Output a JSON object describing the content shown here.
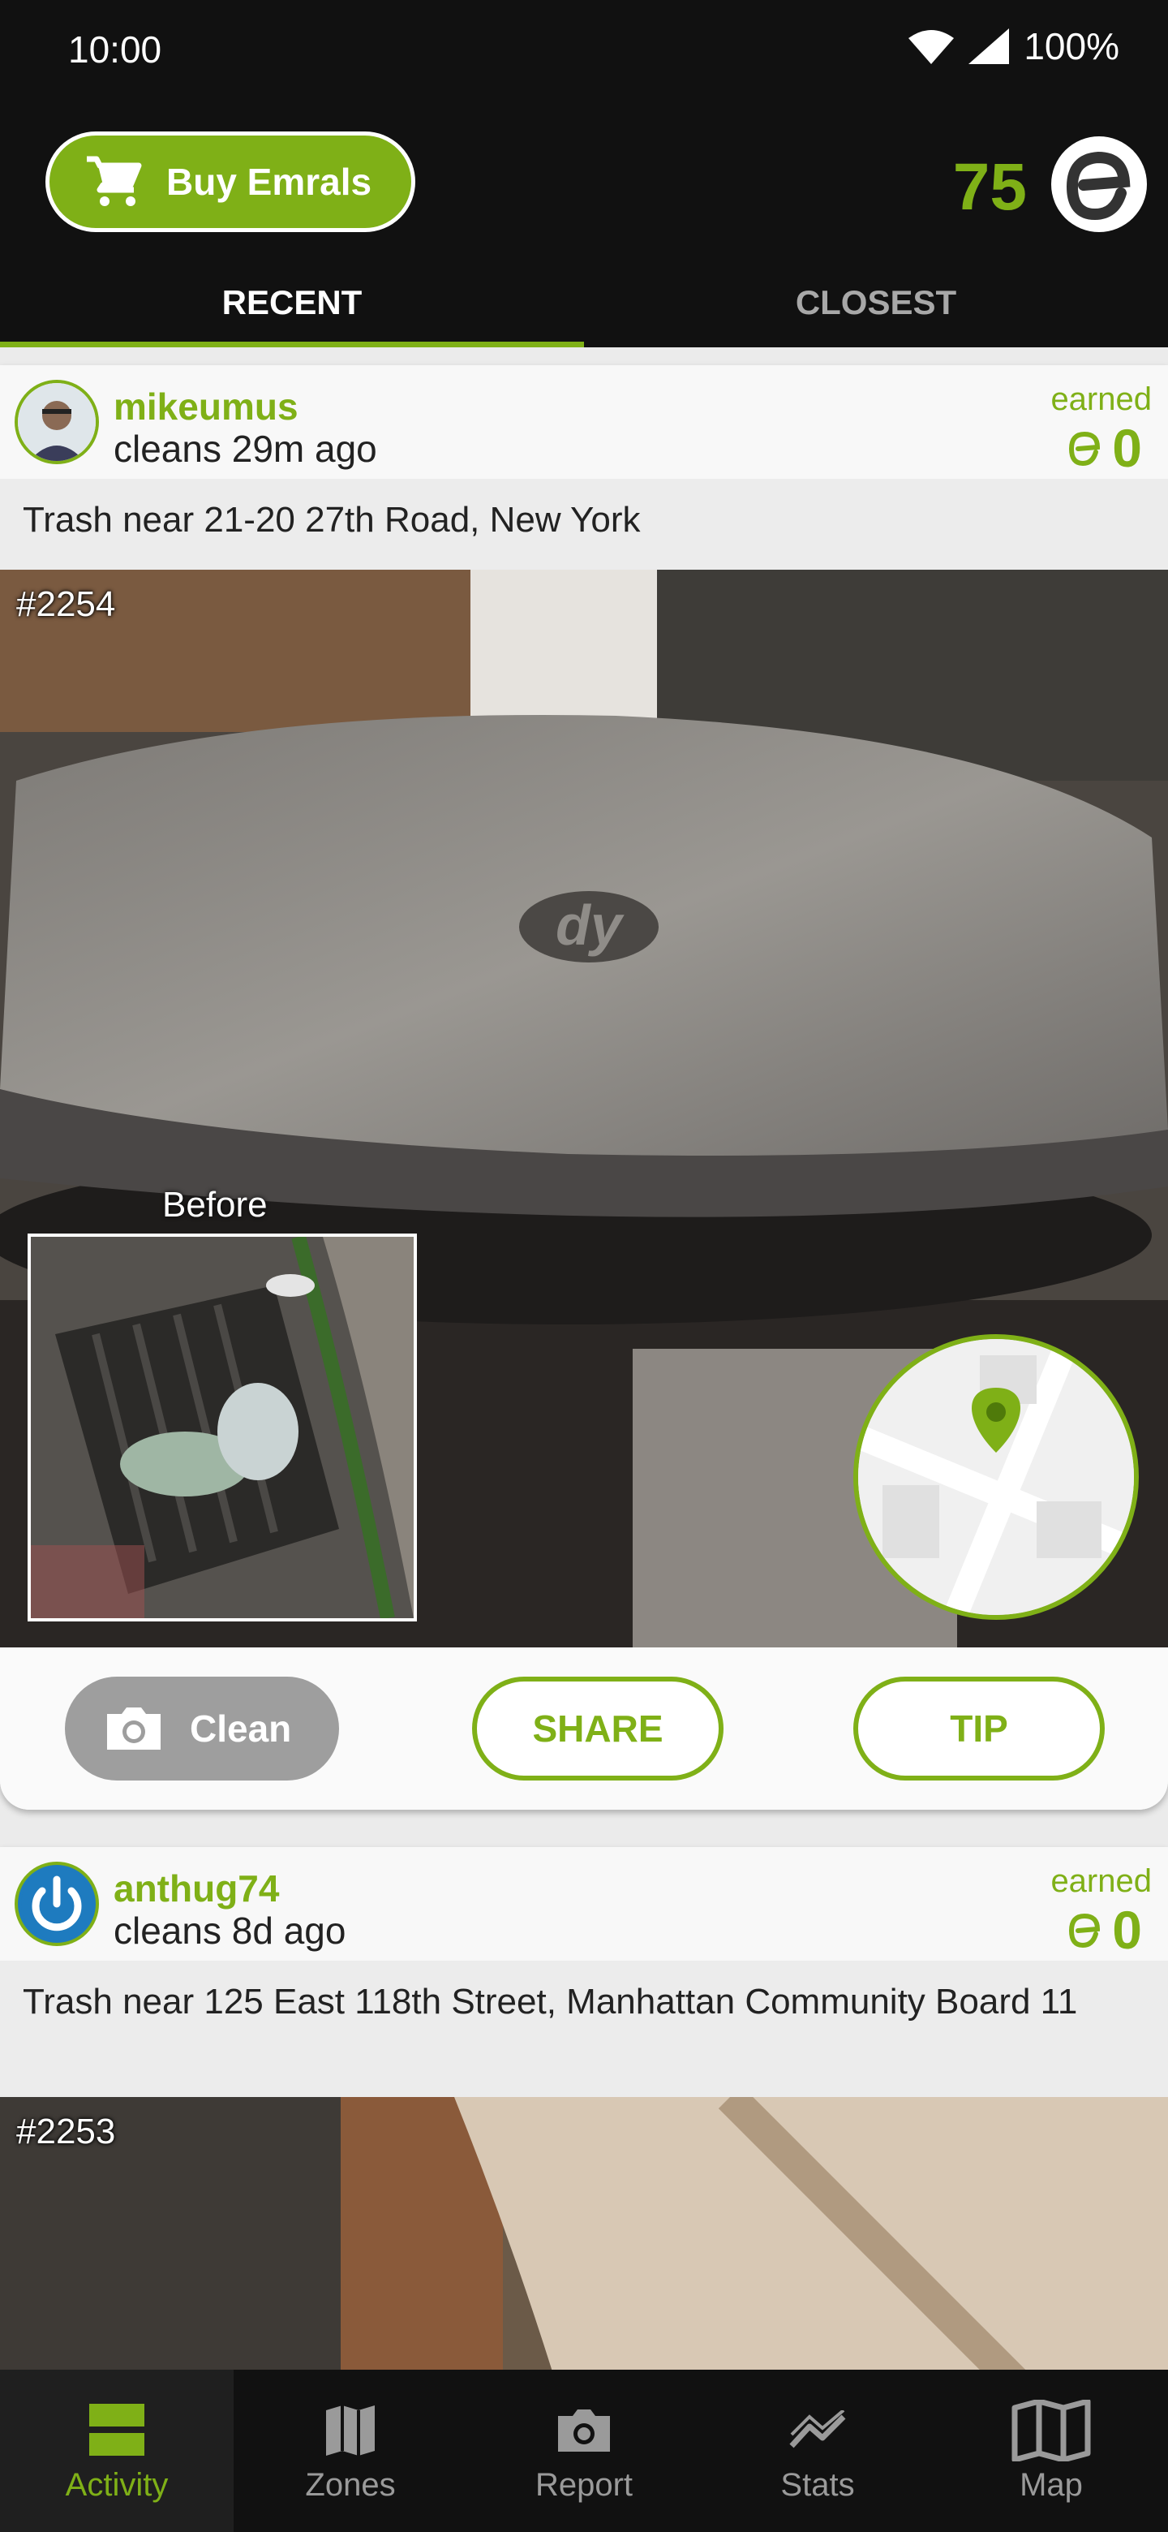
{
  "status_bar": {
    "time": "10:00",
    "battery": "100%"
  },
  "header": {
    "buy_label": "Buy Emrals",
    "balance": "75",
    "tabs": [
      {
        "label": "RECENT"
      },
      {
        "label": "CLOSEST"
      }
    ]
  },
  "feed": [
    {
      "username": "mikeumus",
      "action": "cleans 29m ago",
      "earned_label": "earned",
      "earned_value": "0",
      "location": "Trash near 21-20 27th Road, New York",
      "report_no": "#2254",
      "before_label": "Before",
      "clean_label": "Clean",
      "share_label": "SHARE",
      "tip_label": "TIP"
    },
    {
      "username": "anthug74",
      "action": "cleans 8d ago",
      "earned_label": "earned",
      "earned_value": "0",
      "location": "Trash near 125 East 118th Street, Manhattan Community Board 11",
      "report_no": "#2253"
    }
  ],
  "bottom_nav": [
    {
      "label": "Activity",
      "icon": "activity-icon",
      "active": true
    },
    {
      "label": "Zones",
      "icon": "zones-icon"
    },
    {
      "label": "Report",
      "icon": "camera-icon"
    },
    {
      "label": "Stats",
      "icon": "stats-icon"
    },
    {
      "label": "Map",
      "icon": "map-icon"
    }
  ],
  "colors": {
    "accent": "#7fb017",
    "bar": "#111111",
    "card": "#fafafa"
  }
}
